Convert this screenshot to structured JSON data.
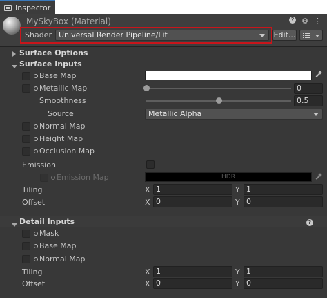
{
  "tab": {
    "label": "Inspector"
  },
  "header": {
    "material_title": "MySkyBox (Material)",
    "shader_label": "Shader",
    "shader_value": "Universal Render Pipeline/Lit",
    "edit_label": "Edit...",
    "highlight_color": "#c8151b"
  },
  "surface_options": {
    "label": "Surface Options"
  },
  "surface_inputs": {
    "label": "Surface Inputs",
    "base_map": {
      "label": "Base Map",
      "color": "#ffffff"
    },
    "metallic_map": {
      "label": "Metallic Map",
      "value": "0",
      "slider_fraction": 0
    },
    "smoothness": {
      "label": "Smoothness",
      "value": "0.5",
      "slider_fraction": 0.5
    },
    "source": {
      "label": "Source",
      "value": "Metallic Alpha"
    },
    "normal_map": {
      "label": "Normal Map"
    },
    "height_map": {
      "label": "Height Map"
    },
    "occlusion_map": {
      "label": "Occlusion Map"
    },
    "emission": {
      "label": "Emission",
      "checked": false
    },
    "emission_map": {
      "label": "Emission Map",
      "hdr_label": "HDR",
      "color": "#000000"
    },
    "tiling": {
      "label": "Tiling",
      "x_label": "X",
      "x": "1",
      "y_label": "Y",
      "y": "1"
    },
    "offset": {
      "label": "Offset",
      "x_label": "X",
      "x": "0",
      "y_label": "Y",
      "y": "0"
    }
  },
  "detail_inputs": {
    "label": "Detail Inputs",
    "mask": {
      "label": "Mask"
    },
    "base_map": {
      "label": "Base Map"
    },
    "normal_map": {
      "label": "Normal Map"
    },
    "tiling": {
      "label": "Tiling",
      "x_label": "X",
      "x": "1",
      "y_label": "Y",
      "y": "1"
    },
    "offset": {
      "label": "Offset",
      "x_label": "X",
      "x": "0",
      "y_label": "Y",
      "y": "0"
    }
  },
  "icons": {
    "help": "question-circle-icon",
    "settings": "gear-icon",
    "more": "vertical-ellipsis-icon",
    "picker": "eyedropper-icon"
  }
}
